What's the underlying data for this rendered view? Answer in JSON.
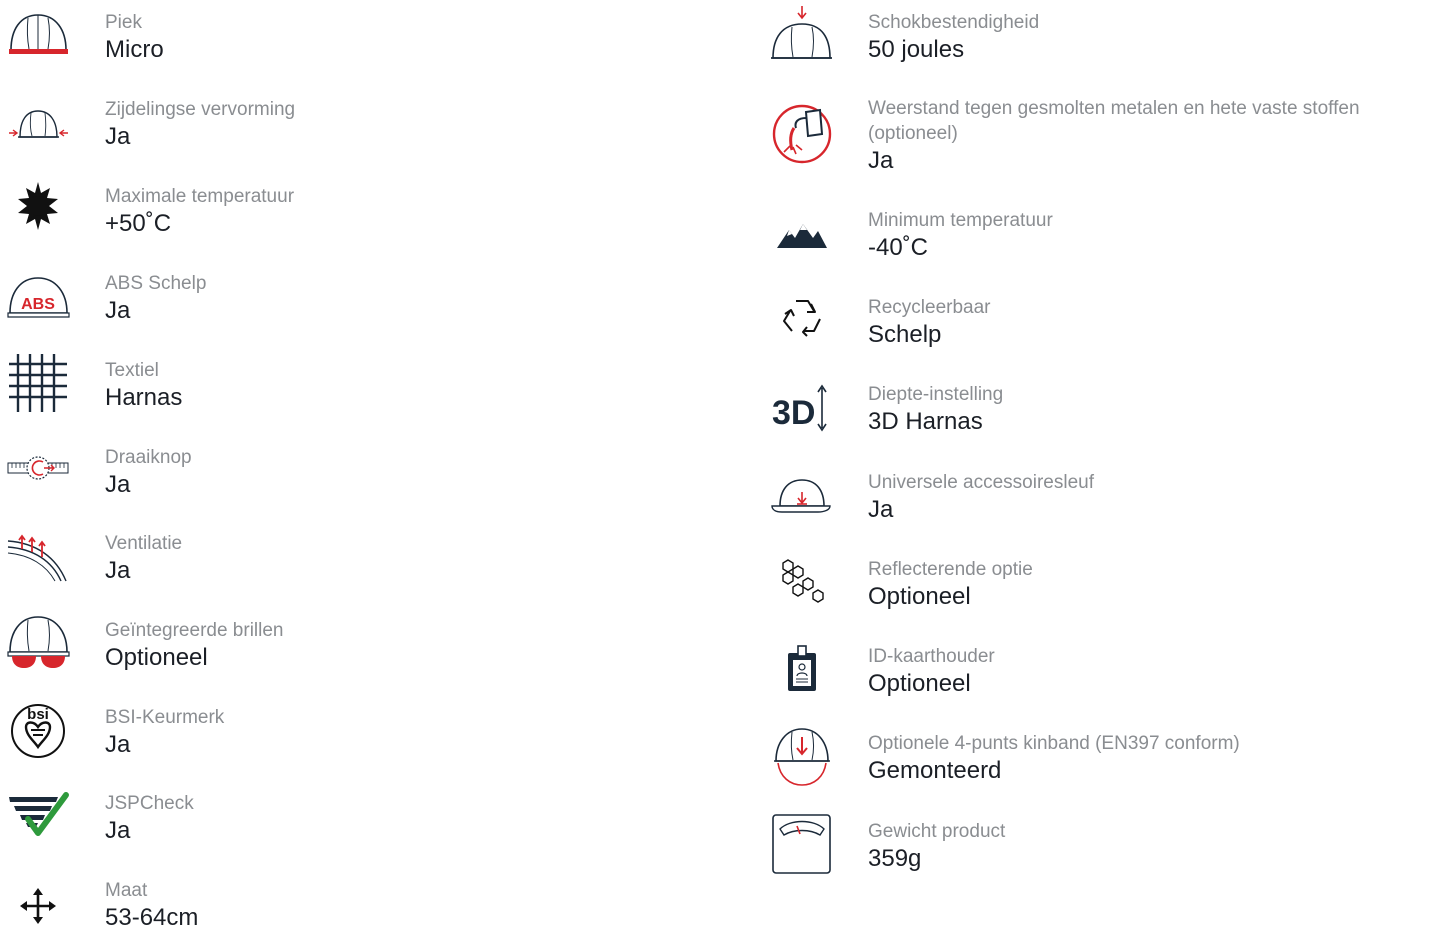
{
  "left": [
    {
      "label": "Piek",
      "value": "Micro",
      "icon": "helmet-peak-icon"
    },
    {
      "label": "Zijdelingse vervorming",
      "value": "Ja",
      "icon": "helmet-lateral-icon"
    },
    {
      "label": "Maximale temperatuur",
      "value": "+50˚C",
      "icon": "sun-icon"
    },
    {
      "label": "ABS Schelp",
      "value": "Ja",
      "icon": "abs-helmet-icon",
      "badge": "ABS"
    },
    {
      "label": "Textiel",
      "value": "Harnas",
      "icon": "textile-icon"
    },
    {
      "label": "Draaiknop",
      "value": "Ja",
      "icon": "dial-icon"
    },
    {
      "label": "Ventilatie",
      "value": "Ja",
      "icon": "ventilation-icon"
    },
    {
      "label": "Geïntegreerde brillen",
      "value": "Optioneel",
      "icon": "helmet-goggles-icon"
    },
    {
      "label": "BSI-Keurmerk",
      "value": "Ja",
      "icon": "bsi-kitemark-icon",
      "badge": "bsi"
    },
    {
      "label": "JSPCheck",
      "value": "Ja",
      "icon": "jspcheck-icon"
    },
    {
      "label": "Maat",
      "value": "53-64cm",
      "icon": "size-arrows-icon"
    }
  ],
  "right": [
    {
      "label": "Schokbestendigheid",
      "value": "50 joules",
      "icon": "helmet-impact-icon"
    },
    {
      "label": "Weerstand tegen gesmolten metalen en hete vaste stoffen (optioneel)",
      "value": "Ja",
      "icon": "molten-metal-icon"
    },
    {
      "label": "Minimum temperatuur",
      "value": "-40˚C",
      "icon": "mountains-icon"
    },
    {
      "label": "Recycleerbaar",
      "value": "Schelp",
      "icon": "recycle-icon"
    },
    {
      "label": "Diepte-instelling",
      "value": "3D Harnas",
      "icon": "3d-harness-icon",
      "badge": "3D"
    },
    {
      "label": "Universele accessoiresleuf",
      "value": "Ja",
      "icon": "accessory-slot-icon"
    },
    {
      "label": "Reflecterende optie",
      "value": "Optioneel",
      "icon": "honeycomb-icon"
    },
    {
      "label": "ID-kaarthouder",
      "value": "Optioneel",
      "icon": "id-card-icon"
    },
    {
      "label": "Optionele 4-punts kinband (EN397 conform)",
      "value": "Gemonteerd",
      "icon": "chinstrap-icon"
    },
    {
      "label": "Gewicht product",
      "value": "359g",
      "icon": "scale-icon"
    }
  ],
  "colors": {
    "accent": "#d7262c",
    "dark": "#1b2a3a",
    "green": "#2e9a3c",
    "label": "#8a8d91",
    "value": "#1b1f26"
  }
}
